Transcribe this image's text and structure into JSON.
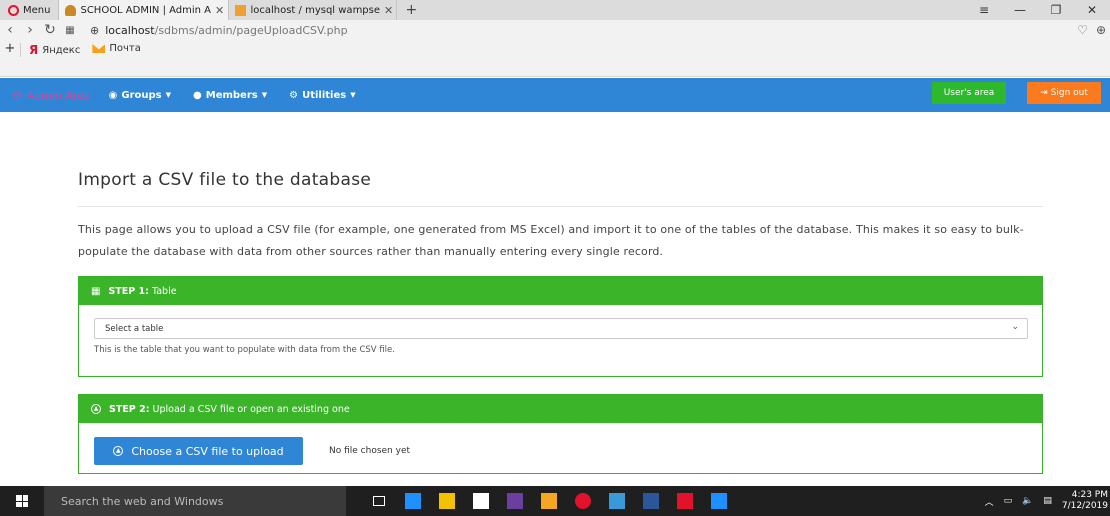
{
  "browser": {
    "menu_label": "Menu",
    "tabs": [
      {
        "title": "SCHOOL ADMIN | Admin A"
      },
      {
        "title": "localhost / mysql wampse"
      }
    ],
    "url_host": "localhost",
    "url_path": "/sdbms/admin/pageUploadCSV.php",
    "bookmarks": [
      {
        "label": "Яндекс"
      },
      {
        "label": "Почта"
      }
    ]
  },
  "navbar": {
    "brand": "Admin Area",
    "items": [
      {
        "label": "Groups"
      },
      {
        "label": "Members"
      },
      {
        "label": "Utilities"
      }
    ],
    "users_area": "User's area",
    "sign_out": "Sign out"
  },
  "page": {
    "title": "Import a CSV file to the database",
    "description": "This page allows you to upload a CSV file (for example, one generated from MS Excel) and import it to one of the tables of the database. This makes it so easy to bulk-populate the database with data from other sources rather than manually entering every single record.",
    "step1": {
      "label": "STEP 1:",
      "title": "Table",
      "select_value": "Select a table",
      "help": "This is the table that you want to populate with data from the CSV file."
    },
    "step2": {
      "label": "STEP 2:",
      "title": "Upload a CSV file or open an existing one",
      "button": "Choose a CSV file to upload",
      "status": "No file chosen yet"
    }
  },
  "taskbar": {
    "search_placeholder": "Search the web and Windows",
    "time": "4:23 PM",
    "date": "7/12/2019",
    "app_colors": [
      "#ffffff",
      "#1e90ff",
      "#f2c200",
      "#ffffff",
      "#6b3fa0",
      "#f5a623",
      "#e0132b",
      "#3a9ad9",
      "#2b579a",
      "#e0132b",
      "#1e90ff"
    ]
  },
  "colors": {
    "navbar": "#2f86d6",
    "success": "#3bb42a",
    "warning": "#fb7a1e",
    "brand": "#c94b9e"
  }
}
